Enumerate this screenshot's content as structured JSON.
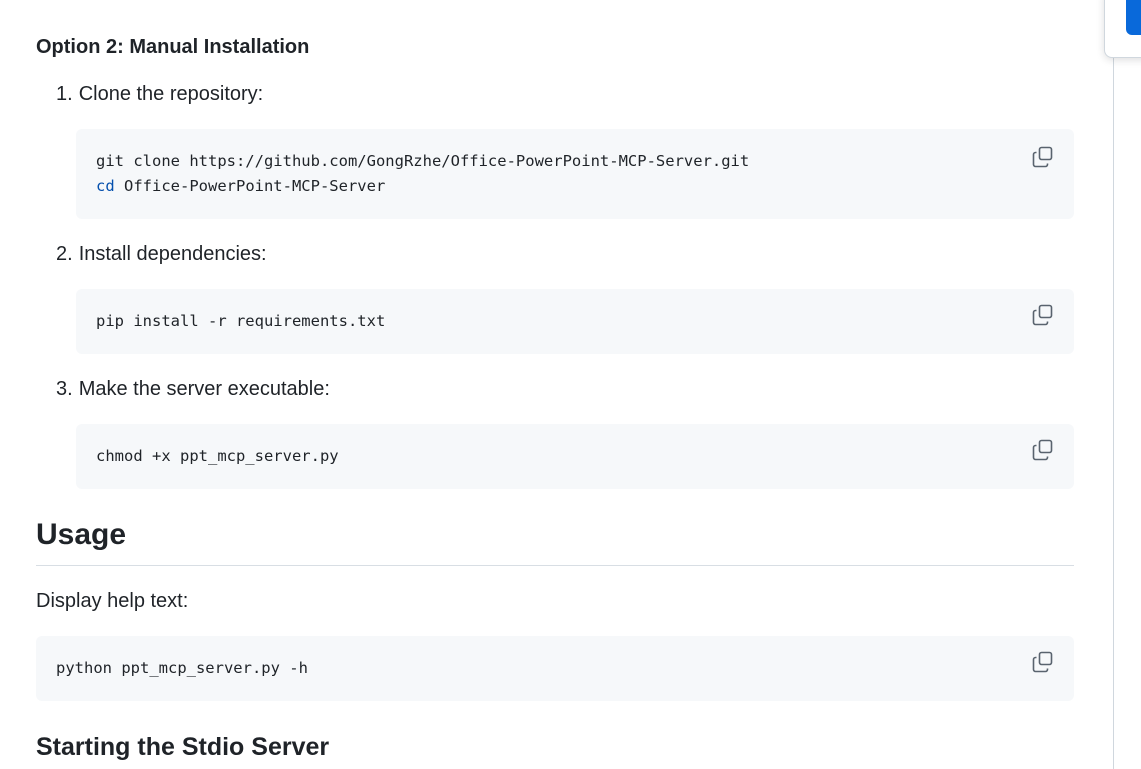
{
  "install": {
    "heading": "Option 2: Manual Installation",
    "steps": [
      {
        "number": "1.",
        "label": "Clone the repository:",
        "code_lines": [
          {
            "keyword": "",
            "text": "git clone https://github.com/GongRzhe/Office-PowerPoint-MCP-Server.git"
          },
          {
            "keyword": "cd",
            "text": " Office-PowerPoint-MCP-Server"
          }
        ]
      },
      {
        "number": "2.",
        "label": "Install dependencies:",
        "code_lines": [
          {
            "keyword": "",
            "text": "pip install -r requirements.txt"
          }
        ]
      },
      {
        "number": "3.",
        "label": "Make the server executable:",
        "code_lines": [
          {
            "keyword": "",
            "text": "chmod +x ppt_mcp_server.py"
          }
        ]
      }
    ]
  },
  "usage": {
    "heading": "Usage",
    "description": "Display help text:",
    "code": "python ppt_mcp_server.py -h"
  },
  "next_section": {
    "heading": "Starting the Stdio Server"
  },
  "icons": {
    "copy": "copy-icon"
  },
  "colors": {
    "code_background": "#f6f8fa",
    "keyword": "#0550ae",
    "accent": "#0969da"
  }
}
